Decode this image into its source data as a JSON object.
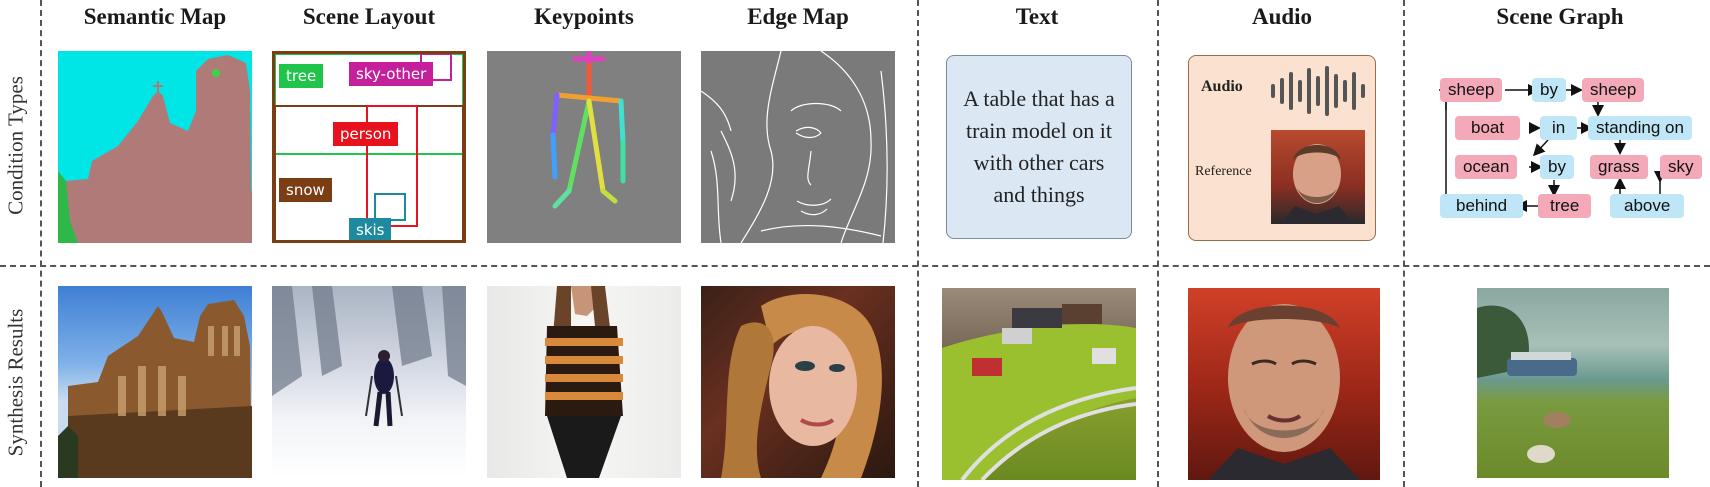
{
  "columns": {
    "semantic_map": "Semantic Map",
    "scene_layout": "Scene Layout",
    "keypoints": "Keypoints",
    "edge_map": "Edge Map",
    "text": "Text",
    "audio": "Audio",
    "scene_graph": "Scene Graph"
  },
  "rows": {
    "conditions": "Condition Types",
    "results": "Synthesis Results"
  },
  "layout_tags": {
    "tree": "tree",
    "sky_other": "sky-other",
    "person": "person",
    "snow": "snow",
    "skis": "skis"
  },
  "text_condition": "A table that has a train model on it with other cars and things",
  "audio_condition": {
    "audio_label": "Audio",
    "reference_label": "Reference"
  },
  "scene_graph_nodes": {
    "sheep1": "sheep",
    "by1": "by",
    "sheep2": "sheep",
    "boat": "boat",
    "in": "in",
    "standing_on": "standing on",
    "ocean": "ocean",
    "by2": "by",
    "grass": "grass",
    "sky": "sky",
    "behind": "behind",
    "tree": "tree",
    "above": "above"
  },
  "colors": {
    "semantic_sky": "#00e5e5",
    "semantic_building": "#b07a78",
    "semantic_tree": "#2fb84a",
    "tag_tree": "#1fc44a",
    "tag_sky_other": "#c4209c",
    "tag_person": "#e8121e",
    "tag_snow": "#7a3d14",
    "tag_skis": "#1d8aa0",
    "node_object": "#f4a9b8",
    "node_relation": "#bfe6f7"
  }
}
